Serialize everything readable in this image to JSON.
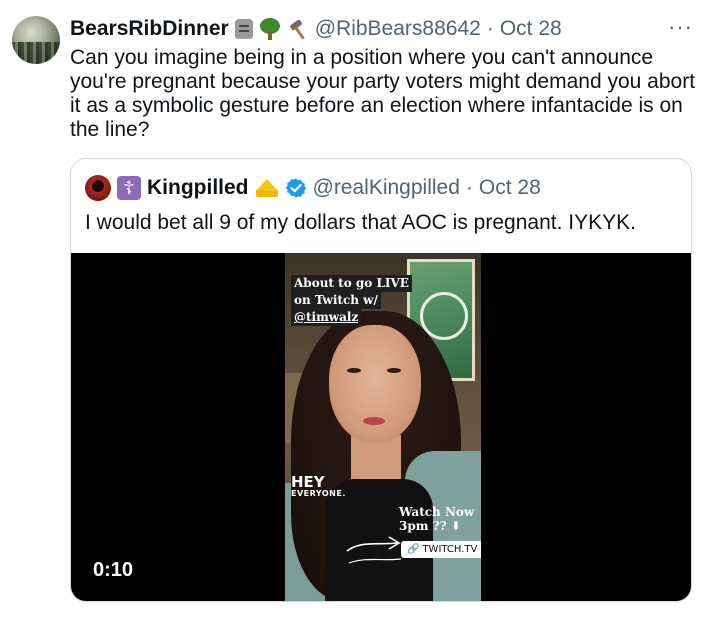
{
  "tweet": {
    "author_name": "BearsRibDinner",
    "author_emojis": [
      "moai-emoji-icon",
      "tree-emoji-icon",
      "hammer-emoji-icon"
    ],
    "handle": "@RibBears88642",
    "separator": "·",
    "date": "Oct 28",
    "more_label": "···",
    "text": "Can you imagine being in a position where you can't announce you're pregnant because your party voters might demand you abort it as a symbolic gesture before an election where infantacide is on the line?"
  },
  "quote": {
    "author_name": "Kingpilled",
    "badge_glyph": "☦",
    "handle": "@realKingpilled",
    "separator": "·",
    "date": "Oct 28",
    "text": "I would bet all 9 of my dollars that AOC is pregnant. IYKYK.",
    "verified_color": "#1d9bf0",
    "video": {
      "duration": "0:10",
      "overlay_line1": "About to go LIVE",
      "overlay_line2": "on Twitch w/",
      "overlay_line3": "@timwalz",
      "hey": "HEY",
      "everyone": "EVERYONE.",
      "watch_line1": "Watch Now",
      "watch_line2": "3pm ?? ⬇",
      "link_label": "TWITCH.TV"
    }
  },
  "colors": {
    "text": "#0f1419",
    "secondary": "#536471",
    "border": "#cfd9de",
    "accent": "#1d9bf0"
  }
}
